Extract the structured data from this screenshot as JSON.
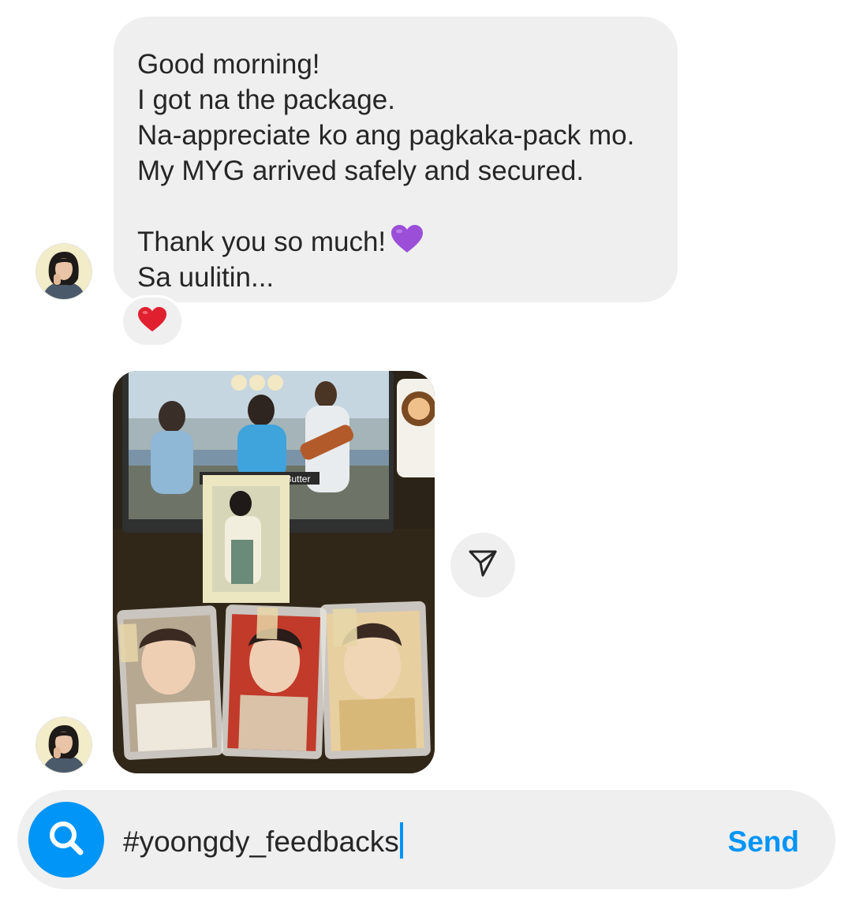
{
  "conversation": {
    "message": {
      "lines": [
        "Good morning!",
        "I got na the package.",
        "Na-appreciate ko ang pagkaka-pack mo.",
        "My MYG arrived safely and secured.",
        "",
        "Thank you so much!",
        "Sa uulitin..."
      ],
      "emoji": "purple-heart-icon"
    },
    "reaction": {
      "emoji": "red-heart-icon"
    },
    "photo": {
      "caption_in_image": "Butter",
      "icons": {
        "share": "send-paper-plane-icon"
      }
    },
    "sender_avatar": "profile-photo"
  },
  "composer": {
    "value": "#yoongdy_feedbacks",
    "search_icon": "search-icon",
    "send_label": "Send"
  },
  "colors": {
    "accent": "#0095f6",
    "bubble": "#efefef",
    "text": "#262626",
    "purple_heart": "#9b4fd8",
    "red_heart": "#e0202f"
  }
}
